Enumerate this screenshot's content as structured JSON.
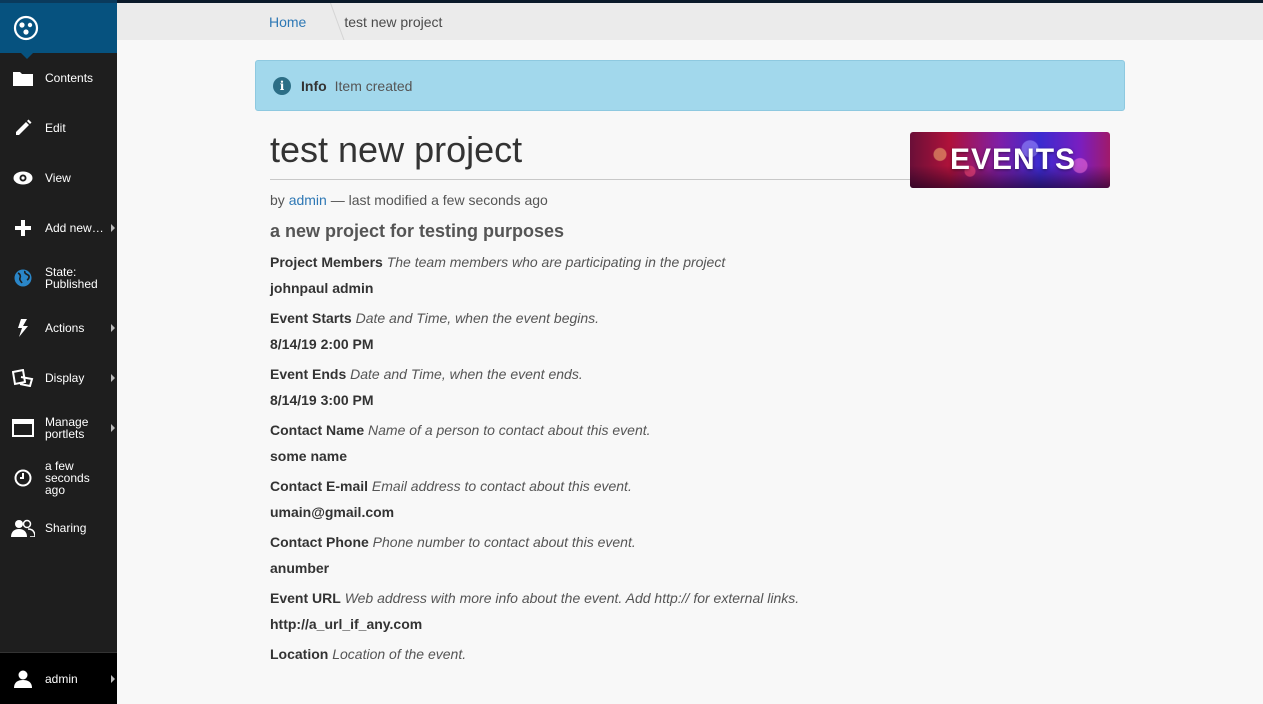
{
  "toolbar": {
    "items": [
      {
        "label": "Contents",
        "icon": "folder-icon"
      },
      {
        "label": "Edit",
        "icon": "pencil-icon"
      },
      {
        "label": "View",
        "icon": "eye-icon"
      },
      {
        "label": "Add new…",
        "icon": "plus-icon"
      },
      {
        "label": "State:\nPublished",
        "icon": "globe-icon"
      },
      {
        "label": "Actions",
        "icon": "bolt-icon"
      },
      {
        "label": "Display",
        "icon": "display-icon"
      },
      {
        "label": "Manage\nportlets",
        "icon": "window-icon"
      },
      {
        "label": "a few\nseconds\nago",
        "icon": "clock-icon"
      },
      {
        "label": "Sharing",
        "icon": "users-icon"
      }
    ],
    "user": "admin"
  },
  "breadcrumb": {
    "home": "Home",
    "current": "test new project"
  },
  "alert": {
    "title": "Info",
    "text": "Item created",
    "icon": "info-icon"
  },
  "page": {
    "title": "test new project",
    "image_text": "EVENTS",
    "byline_prefix": "by",
    "author": "admin",
    "byline_suffix": "— last modified a few seconds ago",
    "description": "a new project for testing purposes"
  },
  "fields": [
    {
      "label": "Project Members",
      "help": "The team members who are participating in the project",
      "value": "johnpaul admin"
    },
    {
      "label": "Event Starts",
      "help": "Date and Time, when the event begins.",
      "value": "8/14/19 2:00 PM"
    },
    {
      "label": "Event Ends",
      "help": "Date and Time, when the event ends.",
      "value": "8/14/19 3:00 PM"
    },
    {
      "label": "Contact Name",
      "help": "Name of a person to contact about this event.",
      "value": "some name"
    },
    {
      "label": "Contact E-mail",
      "help": "Email address to contact about this event.",
      "value": "umain@gmail.com"
    },
    {
      "label": "Contact Phone",
      "help": "Phone number to contact about this event.",
      "value": "anumber"
    },
    {
      "label": "Event URL",
      "help": "Web address with more info about the event. Add http:// for external links.",
      "value": "http://a_url_if_any.com"
    },
    {
      "label": "Location",
      "help": "Location of the event.",
      "value": ""
    }
  ],
  "colors": {
    "toolbar_bg": "#1e1e1e",
    "logo_bg": "#06527f",
    "link": "#2e78b5",
    "alert_bg": "#a2d8ec"
  }
}
